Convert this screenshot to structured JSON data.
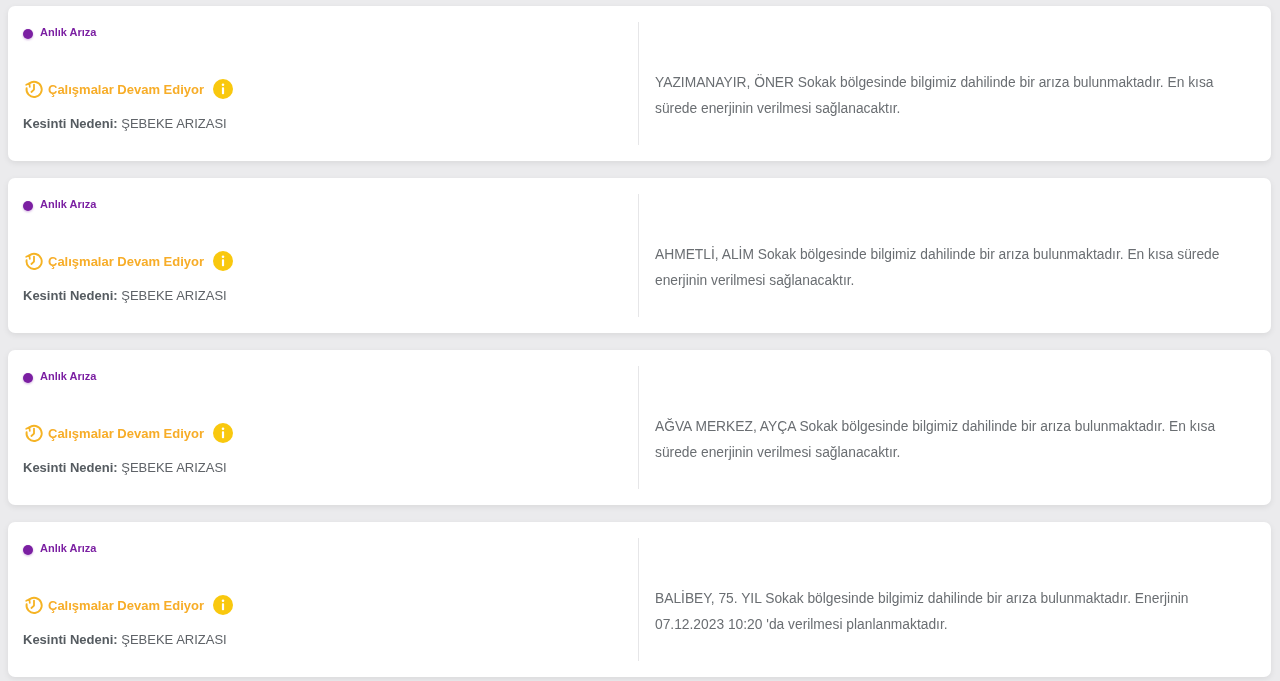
{
  "outages": [
    {
      "type": "Anlık Arıza",
      "status": "Çalışmalar Devam Ediyor",
      "reason_label": "Kesinti Nedeni:",
      "reason": "ŞEBEKE ARIZASI",
      "description": "YAZIMANAYIR, ÖNER Sokak bölgesinde bilgimiz dahilinde bir arıza bulunmaktadır. En kısa sürede enerjinin verilmesi sağlanacaktır."
    },
    {
      "type": "Anlık Arıza",
      "status": "Çalışmalar Devam Ediyor",
      "reason_label": "Kesinti Nedeni:",
      "reason": "ŞEBEKE ARIZASI",
      "description": "AHMETLİ, ALİM Sokak bölgesinde bilgimiz dahilinde bir arıza bulunmaktadır. En kısa sürede enerjinin verilmesi sağlanacaktır."
    },
    {
      "type": "Anlık Arıza",
      "status": "Çalışmalar Devam Ediyor",
      "reason_label": "Kesinti Nedeni:",
      "reason": "ŞEBEKE ARIZASI",
      "description": "AĞVA MERKEZ, AYÇA Sokak bölgesinde bilgimiz dahilinde bir arıza bulunmaktadır. En kısa sürede enerjinin verilmesi sağlanacaktır."
    },
    {
      "type": "Anlık Arıza",
      "status": "Çalışmalar Devam Ediyor",
      "reason_label": "Kesinti Nedeni:",
      "reason": "ŞEBEKE ARIZASI",
      "description": "BALİBEY, 75. YIL Sokak bölgesinde bilgimiz dahilinde bir arıza bulunmaktadır. Enerjinin 07.12.2023 10:20 'da verilmesi planlanmaktadır."
    }
  ]
}
